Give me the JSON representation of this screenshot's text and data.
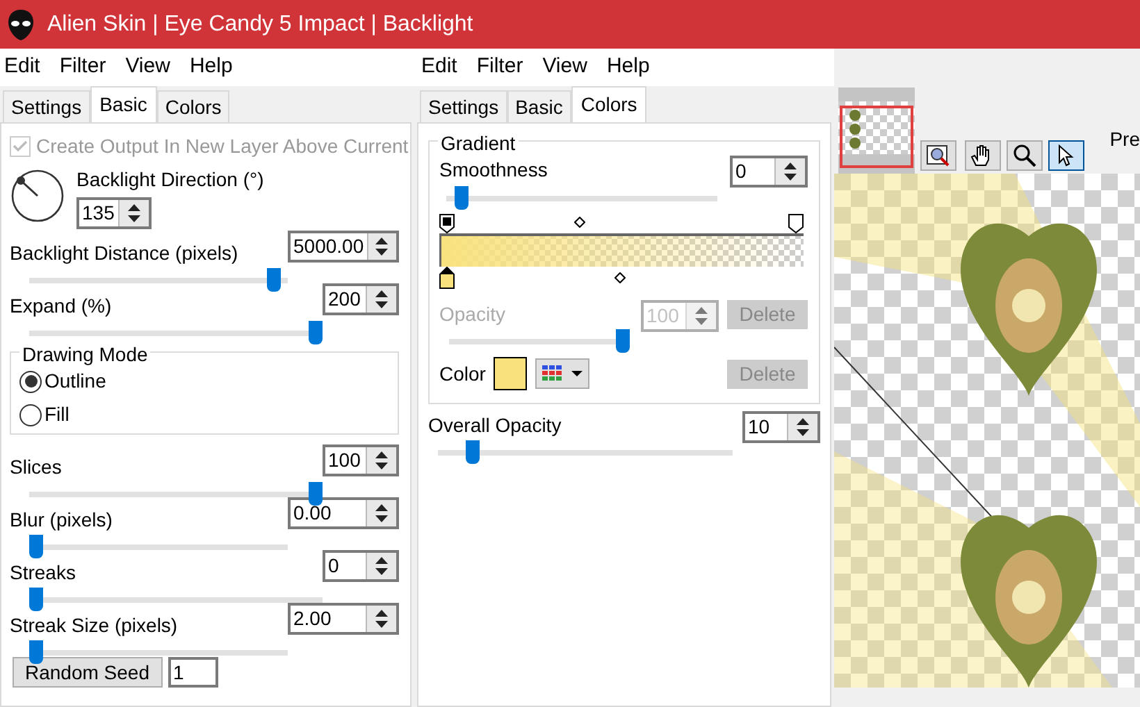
{
  "window": {
    "title": "Alien Skin | Eye Candy 5 Impact | Backlight"
  },
  "left_panel": {
    "menu": [
      "Edit",
      "Filter",
      "View",
      "Help"
    ],
    "tabs": [
      {
        "label": "Settings",
        "selected": false
      },
      {
        "label": "Basic",
        "selected": true
      },
      {
        "label": "Colors",
        "selected": false
      }
    ],
    "create_output": {
      "label": "Create Output In New Layer Above Current",
      "checked": true,
      "disabled": true
    },
    "direction": {
      "label": "Backlight Direction (°)",
      "value": "135"
    },
    "sliders_top": [
      {
        "kind": "float",
        "label": "Backlight Distance (pixels)",
        "value": "5000.00",
        "level": 0.97
      },
      {
        "kind": "int",
        "label": "Expand (%)",
        "value": "200",
        "level": 1
      }
    ],
    "drawing_mode": {
      "title": "Drawing Mode",
      "options": [
        {
          "label": "Outline",
          "selected": true
        },
        {
          "label": "Fill",
          "selected": false
        }
      ]
    },
    "sliders_bottom": [
      {
        "kind": "int",
        "label": "Slices",
        "value": "100",
        "level": 1
      },
      {
        "kind": "float",
        "label": "Blur (pixels)",
        "value": "0.00",
        "level": 0
      },
      {
        "kind": "int",
        "label": "Streaks",
        "value": "0",
        "level": 0
      },
      {
        "kind": "float",
        "label": "Streak Size (pixels)",
        "value": "2.00",
        "level": 0
      }
    ],
    "random_seed": {
      "button": "Random Seed",
      "value": "1"
    }
  },
  "middle_panel": {
    "menu": [
      "Edit",
      "Filter",
      "View",
      "Help"
    ],
    "tabs": [
      {
        "label": "Settings",
        "selected": false
      },
      {
        "label": "Basic",
        "selected": false
      },
      {
        "label": "Colors",
        "selected": true
      }
    ],
    "gradient": {
      "title": "Gradient",
      "smoothness": {
        "label": "Smoothness",
        "value": "0",
        "level": 0.03
      },
      "opacity": {
        "label": "Opacity",
        "value": "100",
        "level": 1,
        "disabled": true
      },
      "opacity_delete": {
        "label": "Delete",
        "disabled": true
      },
      "color": {
        "label": "Color",
        "color": "#f9e27d"
      },
      "color_delete": {
        "label": "Delete",
        "disabled": true
      }
    },
    "overall_opacity": {
      "label": "Overall Opacity",
      "value": "10",
      "level": 0.1
    }
  },
  "preview": {
    "tools": [
      {
        "kind": "zoom-fit",
        "selected": false
      },
      {
        "kind": "hand",
        "selected": false
      },
      {
        "kind": "zoom",
        "selected": false
      },
      {
        "kind": "pointer",
        "selected": true
      }
    ],
    "label": "Pre"
  }
}
